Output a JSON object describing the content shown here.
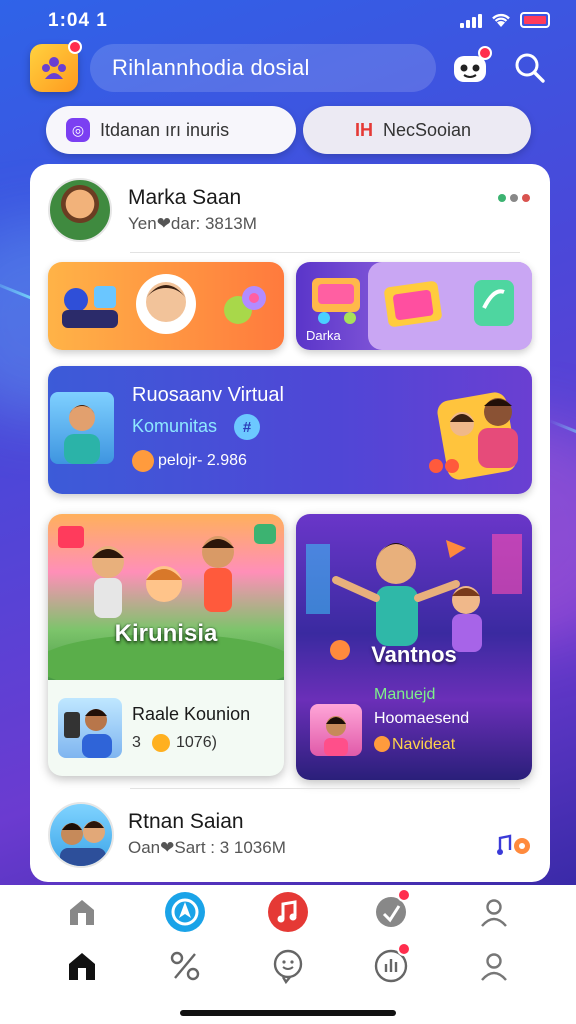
{
  "status_bar": {
    "time": "1:04 1"
  },
  "header": {
    "title": "Rihlannhodia dosial"
  },
  "chips": [
    {
      "label": "Itdanan ırı inuris",
      "icon": "chat-bubble-icon"
    },
    {
      "label": "NecSooian",
      "icon_text": "IH"
    }
  ],
  "feed": {
    "top_profile": {
      "name": "Marka Saan",
      "sub": "Yen❤dar: 3813M"
    },
    "tiles": [
      {
        "label": ""
      },
      {
        "label": "Darka"
      }
    ],
    "banner": {
      "title": "Ruosaanv Virtual",
      "subtitle": "Komunitas",
      "subtitle_icon": "#",
      "stat": "pelojr- 2.986"
    },
    "card_left": {
      "headline": "Kirunisia",
      "title": "Raale Kounion",
      "stat_prefix": "3",
      "stat": "1076)"
    },
    "card_right": {
      "headline": "Vantnos",
      "line1": "Manuejd",
      "line2": "Hoomaesend",
      "line3": "Navideat"
    },
    "bottom_profile": {
      "name": "Rtnan Saian",
      "sub": "Oan❤Sart : 3 1036M"
    }
  },
  "colors": {
    "accent": "#4a48d9",
    "brand_purple": "#7b3ff2",
    "alert_red": "#ff2d4d",
    "music_red": "#e53935",
    "online_green": "#3cb371"
  }
}
